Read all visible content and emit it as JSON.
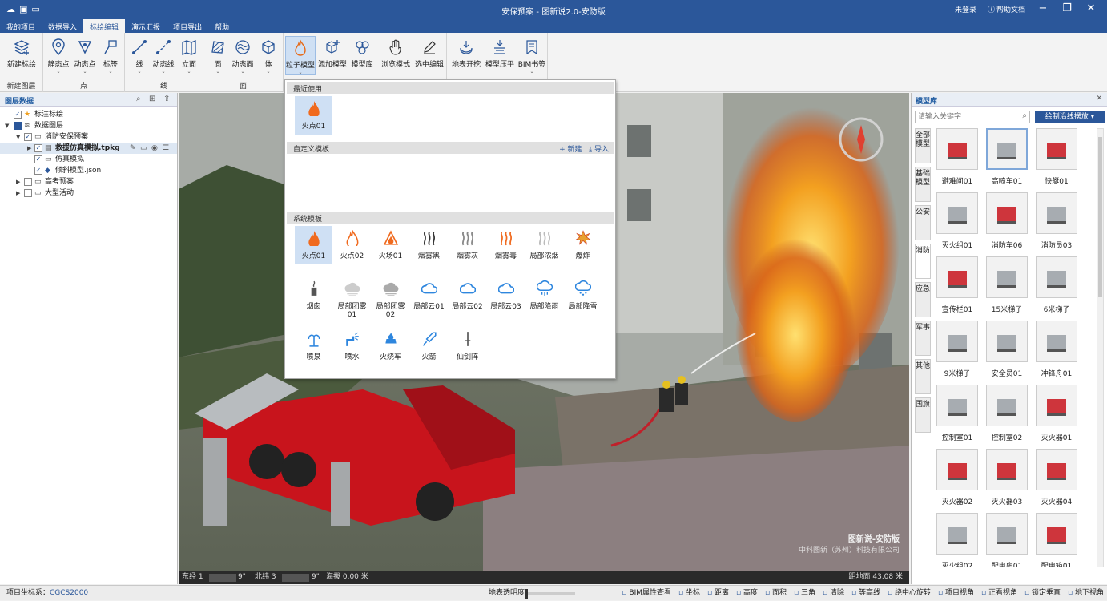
{
  "window": {
    "title": "安保预案 - 图新说2.0-安防版",
    "login": "未登录",
    "help": "帮助文档"
  },
  "menu": [
    {
      "label": "我的项目"
    },
    {
      "label": "数据导入"
    },
    {
      "label": "标绘编辑",
      "active": true
    },
    {
      "label": "演示汇报"
    },
    {
      "label": "项目导出"
    },
    {
      "label": "帮助"
    }
  ],
  "ribbon": {
    "groups": [
      "新建图层",
      "点",
      "线",
      "面"
    ],
    "buttons": {
      "new_mark": "新建标绘",
      "static_point": "静态点",
      "dynamic_point": "动态点",
      "label": "标签",
      "line": "线",
      "dynamic_line": "动态线",
      "facade": "立面",
      "face": "面",
      "dynamic_face": "动态面",
      "body": "体",
      "particle": "粒子模型",
      "add_model": "添加模型",
      "model_lib": "模型库",
      "browse": "浏览模式",
      "select_edit": "选中编辑",
      "excavate": "地表开挖",
      "flatten": "模型压平",
      "bim_bookmark": "BIM书签"
    }
  },
  "layers": {
    "title": "图层数据",
    "items": [
      {
        "label": "标注标绘",
        "icon": "star"
      },
      {
        "label": "数据图层",
        "icon": "layers"
      },
      {
        "label": "消防安保预案",
        "icon": "folder"
      },
      {
        "label": "救援仿真模拟.tpkg",
        "icon": "file"
      },
      {
        "label": "仿真模拟",
        "icon": "folder"
      },
      {
        "label": "倾斜模型.json",
        "icon": "diamond"
      },
      {
        "label": "高考预案",
        "icon": "folder"
      },
      {
        "label": "大型活动",
        "icon": "folder"
      }
    ]
  },
  "popup": {
    "recent_title": "最近使用",
    "recent": [
      {
        "label": "火点01"
      }
    ],
    "custom_title": "自定义模板",
    "new": "+ 新建",
    "import": "⤓ 导入",
    "system_title": "系统模板",
    "system": [
      {
        "label": "火点01",
        "icon": "flame",
        "color": "#f06a1e"
      },
      {
        "label": "火点02",
        "icon": "flame-outline",
        "color": "#f06a1e"
      },
      {
        "label": "火场01",
        "icon": "fire-field",
        "color": "#f06a1e"
      },
      {
        "label": "烟雾黑",
        "icon": "smoke",
        "color": "#333333"
      },
      {
        "label": "烟雾灰",
        "icon": "smoke",
        "color": "#888888"
      },
      {
        "label": "烟雾毒",
        "icon": "smoke",
        "color": "#f06a1e"
      },
      {
        "label": "局部浓烟",
        "icon": "smoke",
        "color": "#bbbbbb"
      },
      {
        "label": "爆炸",
        "icon": "explosion",
        "color": "#e8a030"
      },
      {
        "label": "烟囱",
        "icon": "chimney",
        "color": "#555555"
      },
      {
        "label": "局部团雾01",
        "icon": "fog-cloud",
        "color": "#cccccc"
      },
      {
        "label": "局部团雾02",
        "icon": "fog-cloud",
        "color": "#aaaaaa"
      },
      {
        "label": "局部云01",
        "icon": "cloud",
        "color": "#2e86de"
      },
      {
        "label": "局部云02",
        "icon": "cloud",
        "color": "#2e86de"
      },
      {
        "label": "局部云03",
        "icon": "cloud",
        "color": "#2e86de"
      },
      {
        "label": "局部降雨",
        "icon": "rain-cloud",
        "color": "#2e86de"
      },
      {
        "label": "局部降雪",
        "icon": "snow-cloud",
        "color": "#2e86de"
      },
      {
        "label": "喷泉",
        "icon": "fountain",
        "color": "#2e86de"
      },
      {
        "label": "喷水",
        "icon": "water-spray",
        "color": "#2e86de"
      },
      {
        "label": "火烧车",
        "icon": "burning-car",
        "color": "#2e86de"
      },
      {
        "label": "火箭",
        "icon": "rocket",
        "color": "#2e86de"
      },
      {
        "label": "仙剑阵",
        "icon": "sword",
        "color": "#555555"
      }
    ]
  },
  "scene": {
    "watermark": "图新说-安防版",
    "company": "中科图新（苏州）科技有限公司",
    "lon_label": "东经 1",
    "lon_tail": "9\"",
    "lat_label": "北纬 3",
    "lat_tail": "9\"",
    "alt": "海拔 0.00 米",
    "dist": "距地面 43.08 米"
  },
  "models": {
    "title": "模型库",
    "search_placeholder": "请输入关键字",
    "draw_button": "绘制沿线摆放",
    "categories": [
      "全部模型",
      "基础模型",
      "公安",
      "消防",
      "应急",
      "军事",
      "其他",
      "国旗"
    ],
    "items": [
      {
        "label": "避难间01"
      },
      {
        "label": "高喷车01"
      },
      {
        "label": "快艇01"
      },
      {
        "label": "灭火组01"
      },
      {
        "label": "消防车06"
      },
      {
        "label": "消防员03"
      },
      {
        "label": "宣传栏01"
      },
      {
        "label": "15米梯子"
      },
      {
        "label": "6米梯子"
      },
      {
        "label": "9米梯子"
      },
      {
        "label": "安全员01"
      },
      {
        "label": "冲锋舟01"
      },
      {
        "label": "控制室01"
      },
      {
        "label": "控制室02"
      },
      {
        "label": "灭火器01"
      },
      {
        "label": "灭火器02"
      },
      {
        "label": "灭火器03"
      },
      {
        "label": "灭火器04"
      },
      {
        "label": "灭火组02"
      },
      {
        "label": "配电房01"
      },
      {
        "label": "配电箱01"
      }
    ]
  },
  "status": {
    "crs_label": "项目坐标系：",
    "crs": "CGCS2000",
    "transparency": "地表透明度",
    "tools": [
      "BIM属性查看",
      "坐标",
      "距离",
      "高度",
      "面积",
      "三角",
      "清除",
      "等高线",
      "绕中心旋转",
      "项目视角",
      "正看视角",
      "锁定垂直",
      "地下视角"
    ]
  },
  "colors": {
    "brand": "#2b579a",
    "fire": "#f06a1e",
    "truck": "#c8141c"
  }
}
